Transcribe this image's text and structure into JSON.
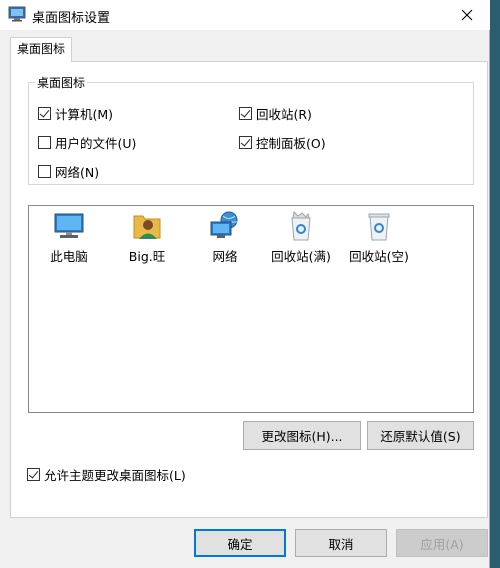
{
  "window": {
    "title": "桌面图标设置",
    "tab_label": "桌面图标"
  },
  "group": {
    "legend": "桌面图标",
    "checkboxes": [
      {
        "label": "计算机(M)",
        "checked": true
      },
      {
        "label": "回收站(R)",
        "checked": true
      },
      {
        "label": "用户的文件(U)",
        "checked": false
      },
      {
        "label": "控制面板(O)",
        "checked": true
      },
      {
        "label": "网络(N)",
        "checked": false
      }
    ]
  },
  "icons": [
    {
      "label": "此电脑",
      "icon": "computer-icon"
    },
    {
      "label": "Big.旺",
      "icon": "user-folder-icon"
    },
    {
      "label": "网络",
      "icon": "network-icon"
    },
    {
      "label": "回收站(满)",
      "icon": "recycle-bin-full-icon"
    },
    {
      "label": "回收站(空)",
      "icon": "recycle-bin-empty-icon"
    }
  ],
  "buttons": {
    "change_icon": "更改图标(H)...",
    "restore_default": "还原默认值(S)",
    "ok": "确定",
    "cancel": "取消",
    "apply": "应用(A)"
  },
  "allow_themes": {
    "label": "允许主题更改桌面图标(L)",
    "checked": true
  }
}
